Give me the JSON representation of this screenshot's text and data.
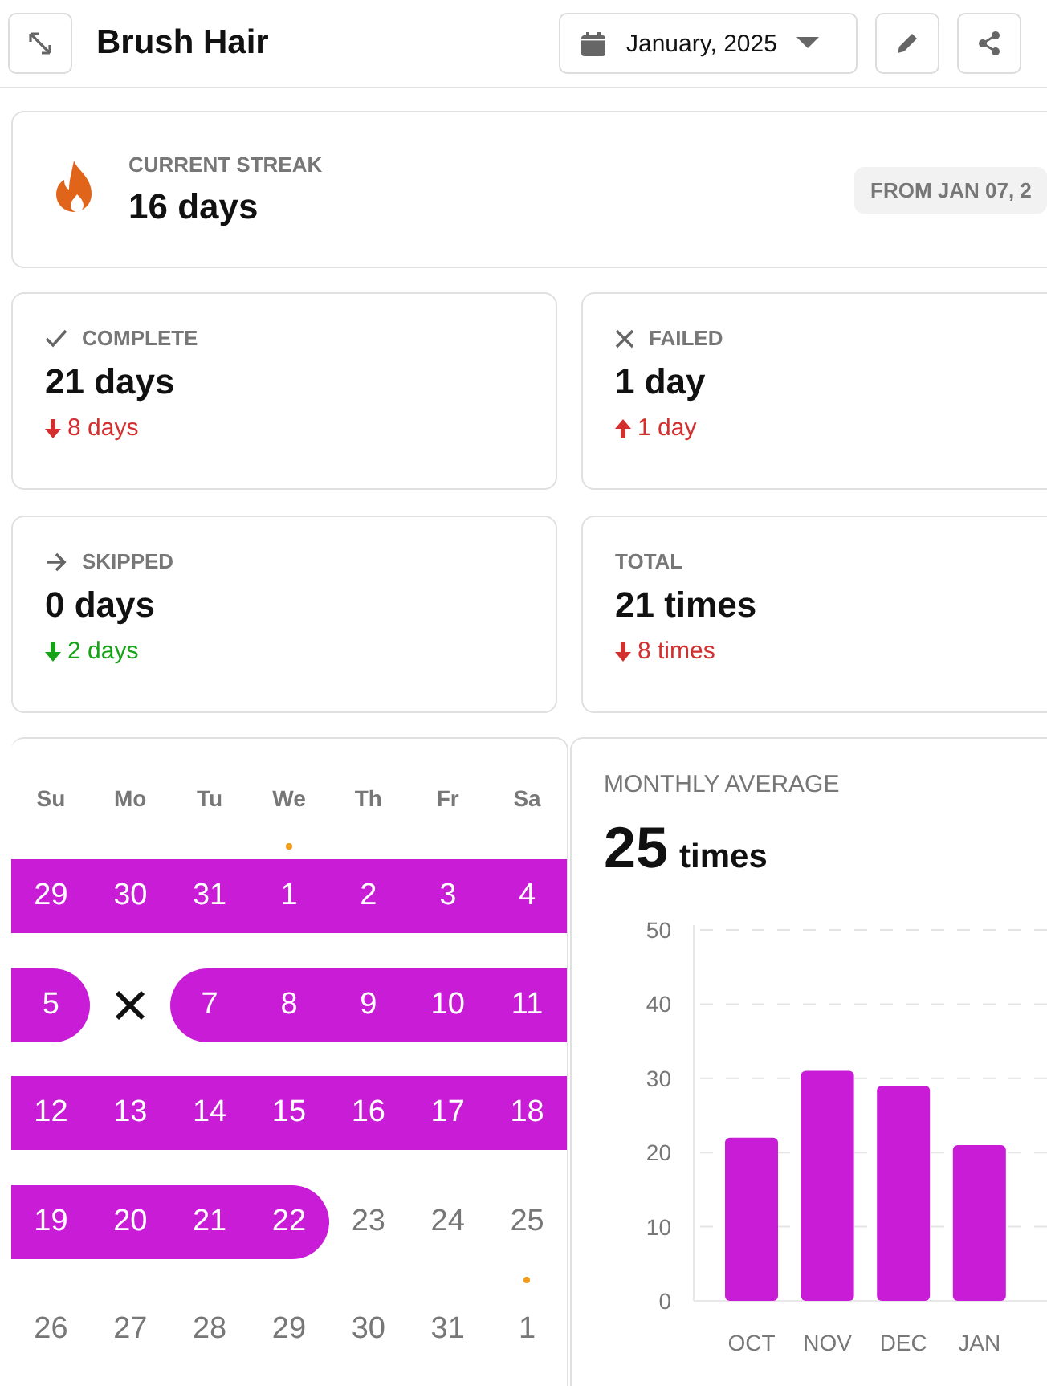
{
  "header": {
    "title": "Brush Hair",
    "month": "January, 2025"
  },
  "streak": {
    "label": "CURRENT STREAK",
    "value": "16 days",
    "badge": "FROM JAN 07, 2"
  },
  "stats": [
    {
      "kind": "complete",
      "label": "COMPLETE",
      "value": "21 days",
      "delta": "8 days",
      "rising": false,
      "good": false
    },
    {
      "kind": "failed",
      "label": "FAILED",
      "value": "1 day",
      "delta": "1 day",
      "rising": true,
      "good": false
    },
    {
      "kind": "skipped",
      "label": "SKIPPED",
      "value": "0 days",
      "delta": "2 days",
      "rising": false,
      "good": true
    },
    {
      "kind": "total",
      "label": "TOTAL",
      "value": "21 times",
      "delta": "8 times",
      "rising": false,
      "good": false
    }
  ],
  "calendar": {
    "weekdays": [
      "Su",
      "Mo",
      "Tu",
      "We",
      "Th",
      "Fr",
      "Sa"
    ],
    "weeks": [
      [
        {
          "label": "29",
          "done": true,
          "failed": false,
          "dot": false
        },
        {
          "label": "30",
          "done": true,
          "failed": false,
          "dot": false
        },
        {
          "label": "31",
          "done": true,
          "failed": false,
          "dot": false
        },
        {
          "label": "1",
          "done": true,
          "failed": false,
          "dot": true
        },
        {
          "label": "2",
          "done": true,
          "failed": false,
          "dot": false
        },
        {
          "label": "3",
          "done": true,
          "failed": false,
          "dot": false
        },
        {
          "label": "4",
          "done": true,
          "failed": false,
          "dot": false
        }
      ],
      [
        {
          "label": "5",
          "done": true,
          "failed": false,
          "dot": false
        },
        {
          "done": false,
          "failed": true,
          "dot": false
        },
        {
          "label": "7",
          "done": true,
          "failed": false,
          "dot": false
        },
        {
          "label": "8",
          "done": true,
          "failed": false,
          "dot": false
        },
        {
          "label": "9",
          "done": true,
          "failed": false,
          "dot": false
        },
        {
          "label": "10",
          "done": true,
          "failed": false,
          "dot": false
        },
        {
          "label": "11",
          "done": true,
          "failed": false,
          "dot": false
        }
      ],
      [
        {
          "label": "12",
          "done": true,
          "failed": false,
          "dot": false
        },
        {
          "label": "13",
          "done": true,
          "failed": false,
          "dot": false
        },
        {
          "label": "14",
          "done": true,
          "failed": false,
          "dot": false
        },
        {
          "label": "15",
          "done": true,
          "failed": false,
          "dot": false
        },
        {
          "label": "16",
          "done": true,
          "failed": false,
          "dot": false
        },
        {
          "label": "17",
          "done": true,
          "failed": false,
          "dot": false
        },
        {
          "label": "18",
          "done": true,
          "failed": false,
          "dot": false
        }
      ],
      [
        {
          "label": "19",
          "done": true,
          "failed": false,
          "dot": false
        },
        {
          "label": "20",
          "done": true,
          "failed": false,
          "dot": false
        },
        {
          "label": "21",
          "done": true,
          "failed": false,
          "dot": false
        },
        {
          "label": "22",
          "done": true,
          "failed": false,
          "dot": false
        },
        {
          "label": "23",
          "done": false,
          "failed": false,
          "dot": false
        },
        {
          "label": "24",
          "done": false,
          "failed": false,
          "dot": false
        },
        {
          "label": "25",
          "done": false,
          "failed": false,
          "dot": false
        }
      ],
      [
        {
          "label": "26",
          "done": false,
          "failed": false,
          "dot": false
        },
        {
          "label": "27",
          "done": false,
          "failed": false,
          "dot": false
        },
        {
          "label": "28",
          "done": false,
          "failed": false,
          "dot": false
        },
        {
          "label": "29",
          "done": false,
          "failed": false,
          "dot": false
        },
        {
          "label": "30",
          "done": false,
          "failed": false,
          "dot": false
        },
        {
          "label": "31",
          "done": false,
          "failed": false,
          "dot": false
        },
        {
          "label": "1",
          "done": false,
          "failed": false,
          "dot": true
        }
      ]
    ]
  },
  "monthly": {
    "label": "MONTHLY AVERAGE",
    "value": "25",
    "unit": "times",
    "chart_data": {
      "type": "bar",
      "categories": [
        "OCT",
        "NOV",
        "DEC",
        "JAN"
      ],
      "series": [
        {
          "color": "#c91cd6",
          "values": [
            22,
            31,
            29,
            21
          ]
        }
      ],
      "ylim": [
        0,
        50
      ],
      "yticks": [
        0,
        10,
        20,
        30,
        40,
        50
      ],
      "grid": true
    }
  }
}
